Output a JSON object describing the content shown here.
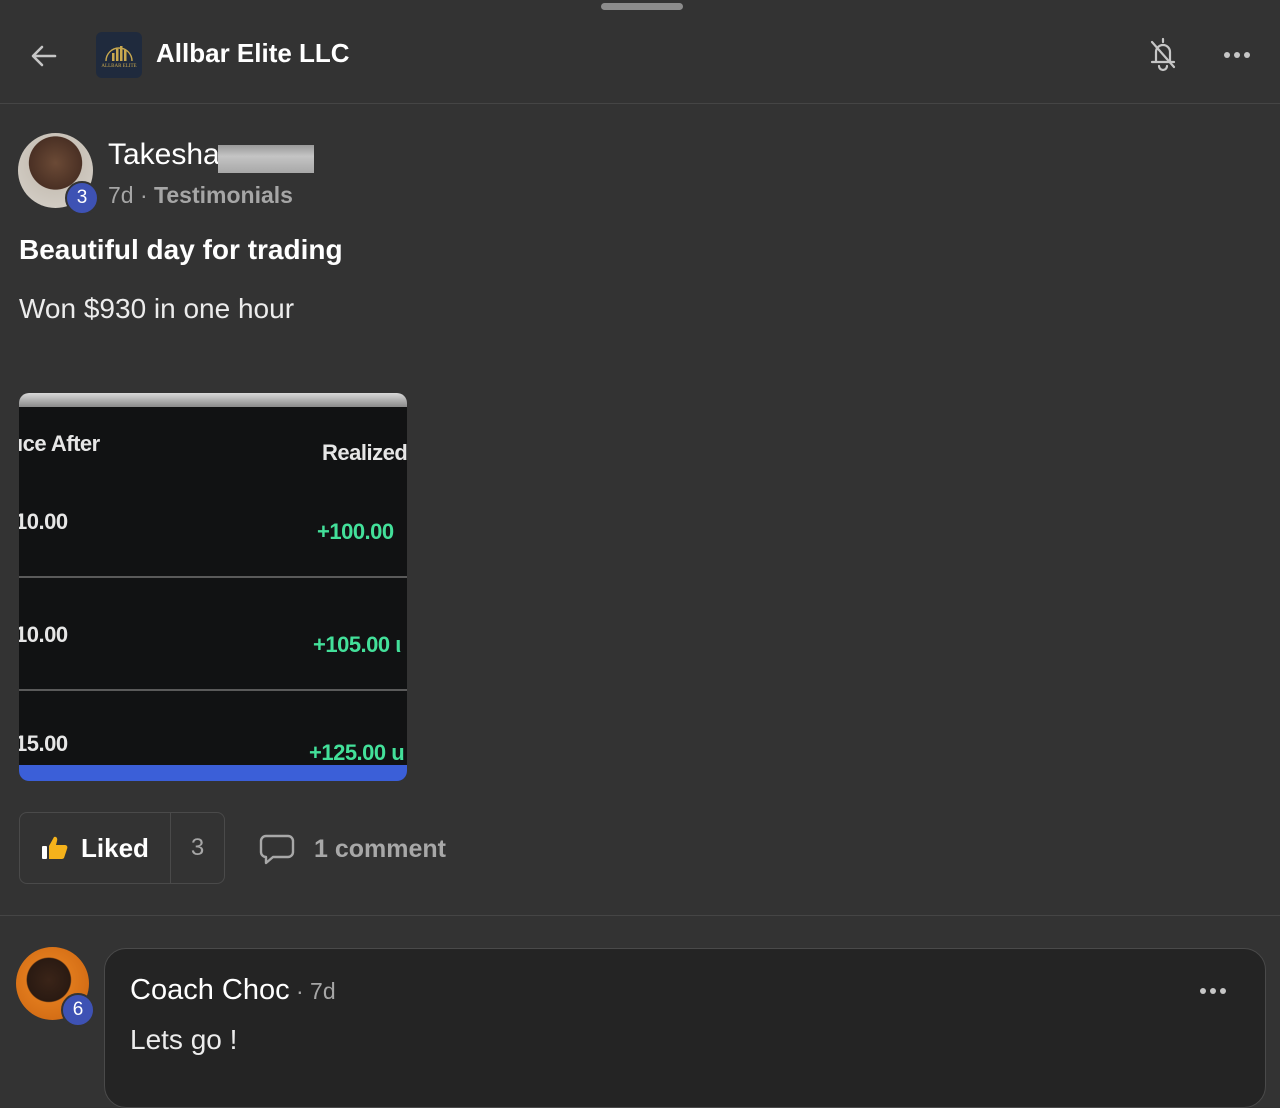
{
  "header": {
    "title": "Allbar Elite LLC",
    "logo_text": "ALLBAR ELITE"
  },
  "post": {
    "author": {
      "name": "Takesha",
      "level": "3",
      "age": "7d",
      "separator": "·",
      "category": "Testimonials"
    },
    "title": "Beautiful day for trading",
    "body": "Won $930 in one hour",
    "image": {
      "header_left": "ıce After",
      "header_right": "Realized",
      "rows": [
        {
          "left": "10.00",
          "right": "+100.00"
        },
        {
          "left": "10.00",
          "right": "+105.00 ι"
        },
        {
          "left": "15.00",
          "right": "+125.00 u"
        }
      ]
    },
    "actions": {
      "like_label": "Liked",
      "like_count": "3",
      "comment_label": "1 comment"
    }
  },
  "comment": {
    "author": "Coach Choc",
    "level": "6",
    "meta": "· 7d",
    "text": "Lets go !"
  },
  "colors": {
    "background": "#333333",
    "badge": "#3e52b4",
    "profit_green": "#43e09a",
    "like_icon": "#f5b21b"
  }
}
